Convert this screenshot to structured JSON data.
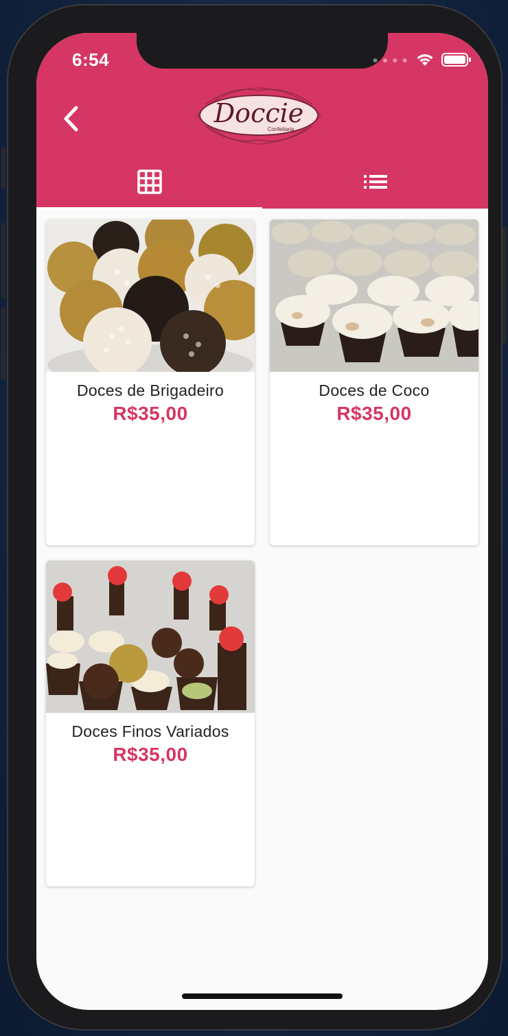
{
  "status_bar": {
    "time": "6:54"
  },
  "header": {
    "logo_text": "Doccie",
    "logo_subtext": "Confeitaria"
  },
  "tabs": [
    {
      "icon": "grid-view-icon",
      "selected": true
    },
    {
      "icon": "list-view-icon",
      "selected": false
    }
  ],
  "products": [
    {
      "name": "Doces de Brigadeiro",
      "price": "R$35,00"
    },
    {
      "name": "Doces de Coco",
      "price": "R$35,00"
    },
    {
      "name": "Doces Finos Variados",
      "price": "R$35,00"
    }
  ],
  "colors": {
    "primary": "#d63664",
    "background": "#fafafa",
    "card": "#ffffff"
  }
}
